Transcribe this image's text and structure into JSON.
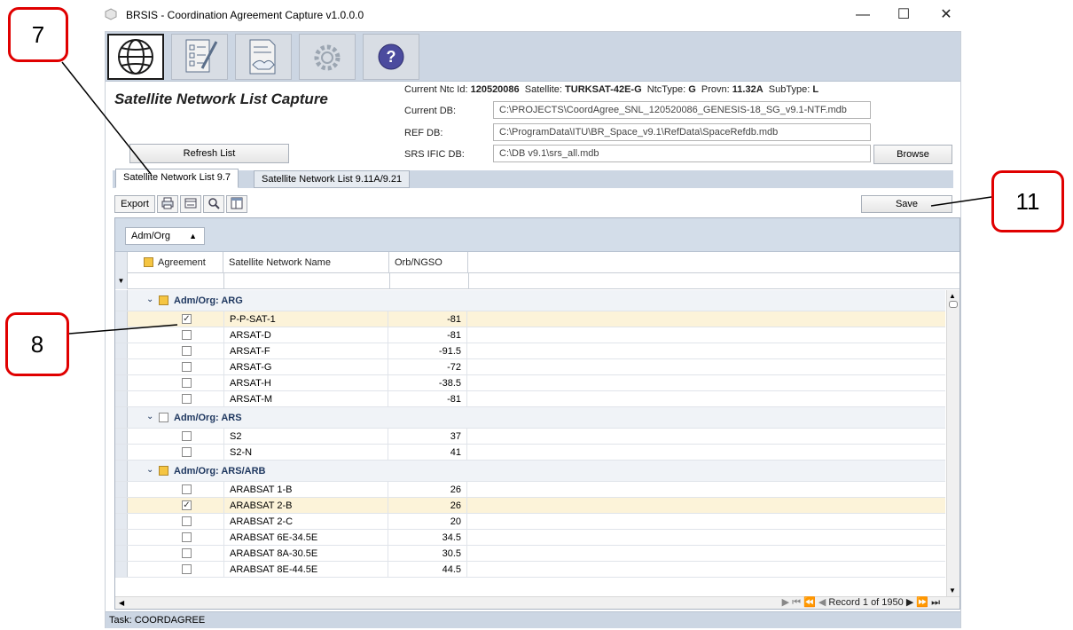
{
  "window": {
    "title": "BRSIS - Coordination Agreement Capture v1.0.0.0",
    "minimize": "—",
    "maximize": "☐",
    "close": "✕"
  },
  "toolbar_icons": [
    "globe-icon",
    "checklist-edit-icon",
    "handshake-document-icon",
    "gear-icon",
    "help-icon"
  ],
  "page_heading": "Satellite Network List Capture",
  "info": {
    "ntc_label": "Current Ntc Id:",
    "ntc_value": "120520086",
    "satellite_label": "Satellite:",
    "satellite_value": "TURKSAT-42E-G",
    "ntctype_label": "NtcType:",
    "ntctype_value": "G",
    "provn_label": "Provn:",
    "provn_value": "11.32A",
    "subtype_label": "SubType:",
    "subtype_value": "L"
  },
  "db": {
    "current_label": "Current DB:",
    "current_value": "C:\\PROJECTS\\CoordAgree_SNL_120520086_GENESIS-18_SG_v9.1-NTF.mdb",
    "ref_label": "REF DB:",
    "ref_value": "C:\\ProgramData\\ITU\\BR_Space_v9.1\\RefData\\SpaceRefdb.mdb",
    "srs_label": "SRS IFIC DB:",
    "srs_value": "C:\\DB v9.1\\srs_all.mdb"
  },
  "buttons": {
    "refresh": "Refresh List",
    "browse": "Browse",
    "save": "Save",
    "export": "Export"
  },
  "tabs": [
    "Satellite Network List 9.7",
    "Satellite Network List 9.11A/9.21"
  ],
  "grid": {
    "group_chip": "Adm/Org",
    "columns": [
      "Agreement",
      "Satellite Network Name",
      "Orb/NGSO"
    ],
    "groups": [
      {
        "label": "Adm/Org: ARG",
        "state": "partial",
        "rows": [
          {
            "name": "P-P-SAT-1",
            "orb": "-81",
            "checked": true
          },
          {
            "name": "ARSAT-D",
            "orb": "-81",
            "checked": false
          },
          {
            "name": "ARSAT-F",
            "orb": "-91.5",
            "checked": false
          },
          {
            "name": "ARSAT-G",
            "orb": "-72",
            "checked": false
          },
          {
            "name": "ARSAT-H",
            "orb": "-38.5",
            "checked": false
          },
          {
            "name": "ARSAT-M",
            "orb": "-81",
            "checked": false
          }
        ]
      },
      {
        "label": "Adm/Org: ARS",
        "state": "unchecked",
        "rows": [
          {
            "name": "S2",
            "orb": "37",
            "checked": false
          },
          {
            "name": "S2-N",
            "orb": "41",
            "checked": false
          }
        ]
      },
      {
        "label": "Adm/Org: ARS/ARB",
        "state": "partial",
        "rows": [
          {
            "name": "ARABSAT 1-B",
            "orb": "26",
            "checked": false
          },
          {
            "name": "ARABSAT 2-B",
            "orb": "26",
            "checked": true
          },
          {
            "name": "ARABSAT 2-C",
            "orb": "20",
            "checked": false
          },
          {
            "name": "ARABSAT 6E-34.5E",
            "orb": "34.5",
            "checked": false
          },
          {
            "name": "ARABSAT 8A-30.5E",
            "orb": "30.5",
            "checked": false
          },
          {
            "name": "ARABSAT 8E-44.5E",
            "orb": "44.5",
            "checked": false
          }
        ]
      }
    ],
    "pager": "Record 1 of 1950"
  },
  "status": "Task: COORDAGREE",
  "callouts": [
    "7",
    "8",
    "11"
  ],
  "colors": {
    "callout": "#e00000",
    "toolbar": "#ccd6e3",
    "selected_row": "#fcf3d9"
  }
}
